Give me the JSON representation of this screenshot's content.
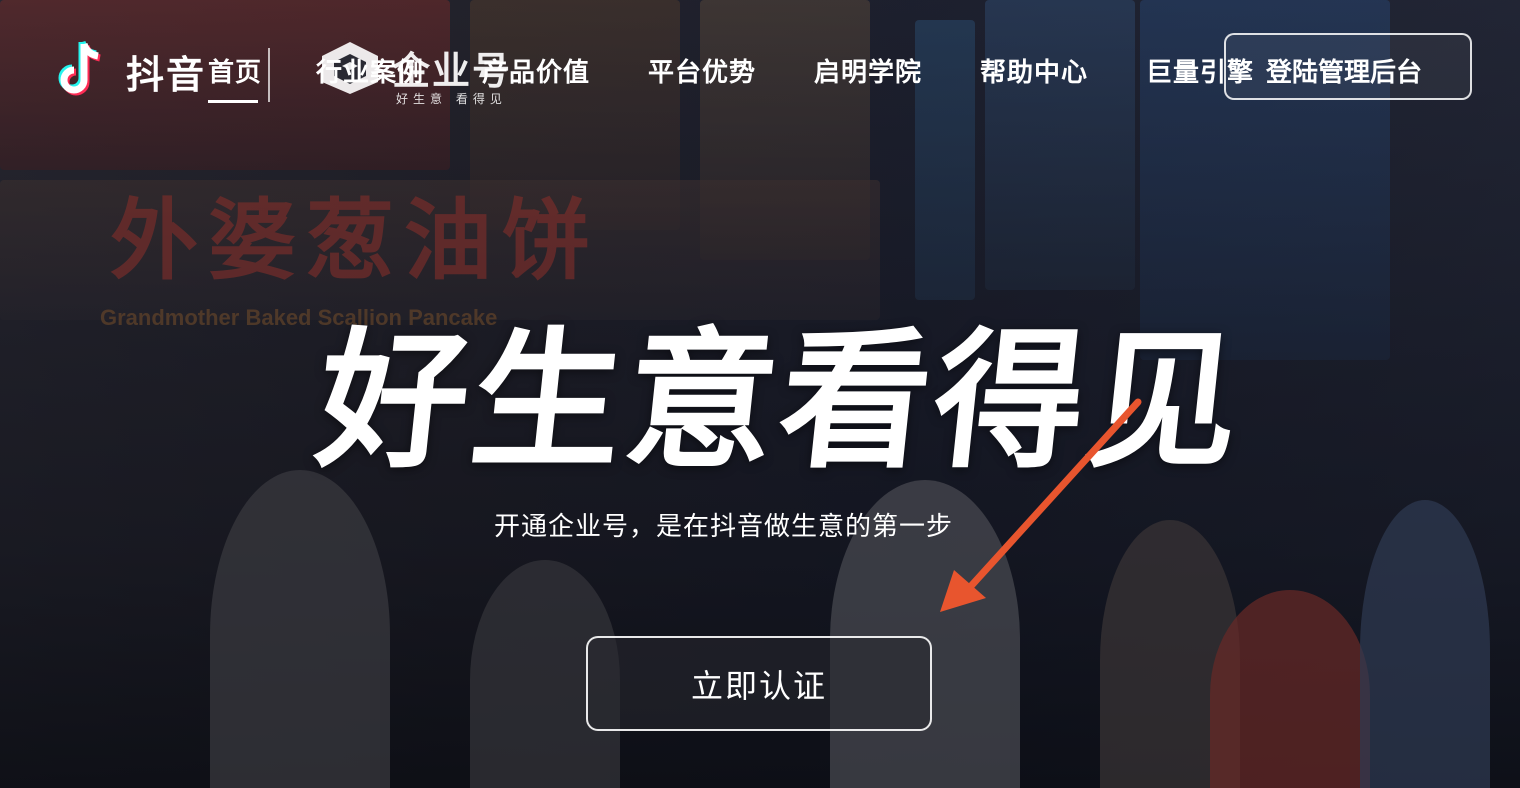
{
  "colors": {
    "accent_arrow": "#e8552e",
    "tiktok_cyan": "#25f4ee",
    "tiktok_red": "#fe2c55"
  },
  "nav": {
    "logo_icon": "tiktok-note-icon",
    "logo_text": "抖音",
    "brand_title": "企业号",
    "brand_subtitle": "好生意 看得见",
    "items": [
      {
        "label": "首页"
      },
      {
        "label": "行业案例"
      },
      {
        "label": "产品价值"
      },
      {
        "label": "平台优势"
      },
      {
        "label": "启明学院"
      },
      {
        "label": "帮助中心"
      },
      {
        "label": "巨量引擎"
      }
    ],
    "login_label": "登陆管理后台"
  },
  "hero": {
    "title": "好生意看得见",
    "subtitle": "开通企业号，是在抖音做生意的第一步",
    "cta_label": "立即认证"
  },
  "background": {
    "sign_text": "外婆葱油饼",
    "sign_en": "Grandmother Baked Scallion Pancake"
  }
}
